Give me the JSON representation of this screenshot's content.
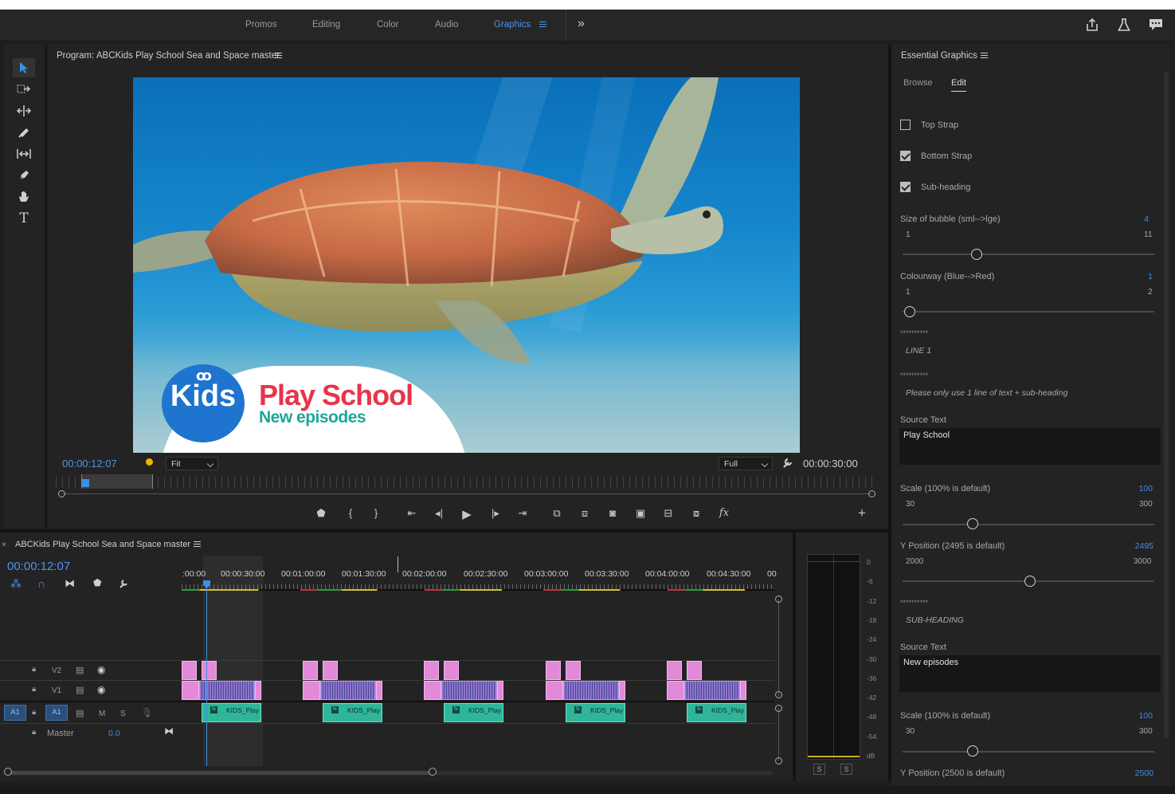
{
  "workspaces": {
    "tabs": [
      "Promos",
      "Editing",
      "Color",
      "Audio",
      "Graphics"
    ],
    "active": "Graphics",
    "overflow_glyph": "»"
  },
  "header_icons": [
    "share-icon",
    "flask-icon",
    "comment-icon"
  ],
  "program_monitor": {
    "title": "Program: ABCKids Play School Sea and Space master",
    "timecode_current": "00:00:12:07",
    "timecode_duration": "00:00:30:00",
    "zoom": "Fit",
    "resolution": "Full",
    "overlay": {
      "logo_mark": "ꝏ",
      "logo_text": "Kids",
      "headline": "Play School",
      "subheadline": "New episodes"
    },
    "fx_glyph": "fx"
  },
  "timeline": {
    "title": "ABCKids Play School Sea and Space master",
    "timecode": "00:00:12:07",
    "ruler": [
      ":00:00",
      "00:00:30:00",
      "00:01:00:00",
      "00:01:30:00",
      "00:02:00:00",
      "00:02:30:00",
      "00:03:00:00",
      "00:03:30:00",
      "00:04:00:00",
      "00:04:30:00",
      "00"
    ],
    "tracks": {
      "v2": "V2",
      "v1": "V1",
      "a1_src": "A1",
      "a1": "A1",
      "mute": "M",
      "solo": "S",
      "master": "Master",
      "master_value": "0.0"
    },
    "clip_label": "KIDS_Play"
  },
  "audio_meter": {
    "scale": [
      "0",
      "-6",
      "-12",
      "-18",
      "-24",
      "-30",
      "-36",
      "-42",
      "-48",
      "-54",
      "dB"
    ],
    "solo_left": "S",
    "solo_right": "S"
  },
  "essential_graphics": {
    "title": "Essential Graphics",
    "tabs": [
      "Browse",
      "Edit"
    ],
    "active_tab": "Edit",
    "checkboxes": [
      {
        "label": "Top Strap",
        "checked": false
      },
      {
        "label": "Bottom Strap",
        "checked": true
      },
      {
        "label": "Sub-heading",
        "checked": true
      }
    ],
    "bubble": {
      "label": "Size of bubble (sml-->lge)",
      "value": "4",
      "min": "1",
      "max": "11"
    },
    "colourway": {
      "label": "Colourway (Blue-->Red)",
      "value": "1",
      "min": "1",
      "max": "2"
    },
    "stars": "**********",
    "line1": "LINE 1",
    "note": "Please only use 1 line of text + sub-heading",
    "source_label": "Source Text",
    "source1": "Play School",
    "scale1": {
      "label": "Scale (100% is default)",
      "value": "100",
      "min": "30",
      "max": "300"
    },
    "ypos1": {
      "label": "Y Position (2495 is default)",
      "value": "2495",
      "min": "2000",
      "max": "3000"
    },
    "subheading": "SUB-HEADING",
    "source2": "New episodes",
    "scale2": {
      "label": "Scale (100% is default)",
      "value": "100",
      "min": "30",
      "max": "300"
    },
    "ypos2": {
      "label": "Y Position (2500 is default)",
      "value": "2500"
    }
  }
}
